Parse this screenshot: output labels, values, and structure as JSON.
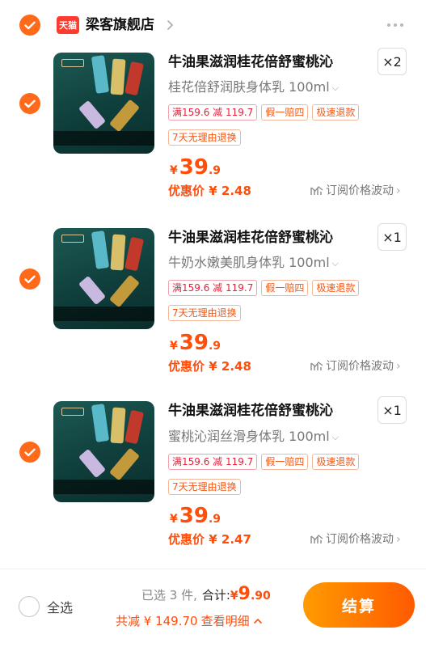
{
  "shop": {
    "badge": "天猫",
    "name": "梁客旗舰店"
  },
  "items": [
    {
      "title": "牛油果滋润桂花倍舒蜜桃沁",
      "quantity": "×2",
      "spec": "桂花倍舒润肤身体乳 100ml",
      "tags": [
        "满159.6 减 119.7",
        "假一赔四",
        "极速退款"
      ],
      "tag_return": "7天无理由退换",
      "price_symbol": "¥",
      "price_int": "39",
      "price_dec": ".9",
      "promo": "优惠价 ¥ 2.48",
      "watch": "订阅价格波动"
    },
    {
      "title": "牛油果滋润桂花倍舒蜜桃沁",
      "quantity": "×1",
      "spec": "牛奶水嫩美肌身体乳 100ml",
      "tags": [
        "满159.6 减 119.7",
        "假一赔四",
        "极速退款"
      ],
      "tag_return": "7天无理由退换",
      "price_symbol": "¥",
      "price_int": "39",
      "price_dec": ".9",
      "promo": "优惠价 ¥ 2.48",
      "watch": "订阅价格波动"
    },
    {
      "title": "牛油果滋润桂花倍舒蜜桃沁",
      "quantity": "×1",
      "spec": "蜜桃沁润丝滑身体乳 100ml",
      "tags": [
        "满159.6 减 119.7",
        "假一赔四",
        "极速退款"
      ],
      "tag_return": "7天无理由退换",
      "price_symbol": "¥",
      "price_int": "39",
      "price_dec": ".9",
      "promo": "优惠价 ¥ 2.47",
      "watch": "订阅价格波动"
    }
  ],
  "footer": {
    "select_all": "全选",
    "selected_count": "已选 3 件,",
    "total_label": "合计:",
    "total_symbol": "¥",
    "total_int": "9",
    "total_dec": ".90",
    "discount": "共减 ¥ 149.70",
    "details": "查看明细",
    "checkout": "结算"
  },
  "colors": {
    "accent": "#ff6a1a",
    "price": "#ff4d0a",
    "checkout_gradient": [
      "#ff9b00",
      "#ff5a00"
    ]
  }
}
